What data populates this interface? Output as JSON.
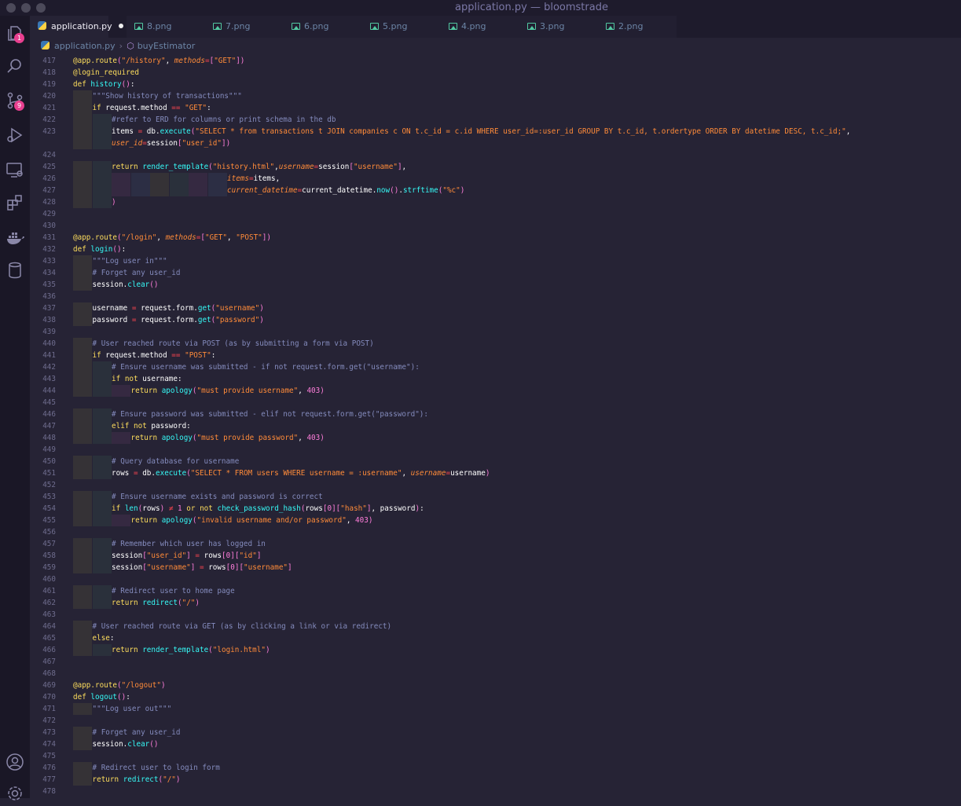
{
  "window": {
    "title": "application.py — bloomstrade"
  },
  "activity_bar": {
    "explorer_badge": "1",
    "source_control_badge": "9"
  },
  "tabs": [
    {
      "label": "application.py",
      "active": true,
      "modified": true,
      "icon": "python-icon"
    },
    {
      "label": "8.png",
      "icon": "image-icon"
    },
    {
      "label": "7.png",
      "icon": "image-icon"
    },
    {
      "label": "6.png",
      "icon": "image-icon"
    },
    {
      "label": "5.png",
      "icon": "image-icon"
    },
    {
      "label": "4.png",
      "icon": "image-icon"
    },
    {
      "label": "3.png",
      "icon": "image-icon"
    },
    {
      "label": "2.png",
      "icon": "image-icon"
    }
  ],
  "breadcrumb": {
    "file": "application.py",
    "symbol": "buyEstimator"
  },
  "lines": [
    {
      "n": "417",
      "indent": 0,
      "t": "@app.route(\"/history\", methods=[\"GET\"])"
    },
    {
      "n": "418",
      "indent": 0,
      "t": "@login_required"
    },
    {
      "n": "419",
      "indent": 0,
      "t": "def history():"
    },
    {
      "n": "420",
      "indent": 1,
      "t": "\"\"\"Show history of transactions\"\"\""
    },
    {
      "n": "421",
      "indent": 1,
      "t": "if request.method == \"GET\":"
    },
    {
      "n": "422",
      "indent": 2,
      "t": "#refer to ERD for columns or print schema in the db"
    },
    {
      "n": "423",
      "indent": 2,
      "t": "items = db.execute(\"SELECT * from transactions t JOIN companies c ON t.c_id = c.id WHERE user_id=:user_id GROUP BY t.c_id, t.ordertype ORDER BY datetime DESC, t.c_id;\","
    },
    {
      "n": "",
      "indent": 2,
      "t": "user_id=session[\"user_id\"])"
    },
    {
      "n": "424",
      "indent": 0,
      "t": ""
    },
    {
      "n": "425",
      "indent": 2,
      "t": "return render_template(\"history.html\",username=session[\"username\"],"
    },
    {
      "n": "426",
      "indent": 8,
      "t": "items=items,"
    },
    {
      "n": "427",
      "indent": 8,
      "t": "current_datetime=current_datetime.now().strftime(\"%c\")"
    },
    {
      "n": "428",
      "indent": 2,
      "t": ")"
    },
    {
      "n": "429",
      "indent": 0,
      "t": ""
    },
    {
      "n": "430",
      "indent": 0,
      "t": ""
    },
    {
      "n": "431",
      "indent": 0,
      "t": "@app.route(\"/login\", methods=[\"GET\", \"POST\"])"
    },
    {
      "n": "432",
      "indent": 0,
      "t": "def login():"
    },
    {
      "n": "433",
      "indent": 1,
      "t": "\"\"\"Log user in\"\"\""
    },
    {
      "n": "434",
      "indent": 1,
      "t": "# Forget any user_id"
    },
    {
      "n": "435",
      "indent": 1,
      "t": "session.clear()"
    },
    {
      "n": "436",
      "indent": 0,
      "t": ""
    },
    {
      "n": "437",
      "indent": 1,
      "t": "username = request.form.get(\"username\")"
    },
    {
      "n": "438",
      "indent": 1,
      "t": "password = request.form.get(\"password\")"
    },
    {
      "n": "439",
      "indent": 0,
      "t": ""
    },
    {
      "n": "440",
      "indent": 1,
      "t": "# User reached route via POST (as by submitting a form via POST)"
    },
    {
      "n": "441",
      "indent": 1,
      "t": "if request.method == \"POST\":"
    },
    {
      "n": "442",
      "indent": 2,
      "t": "# Ensure username was submitted - if not request.form.get(\"username\"):"
    },
    {
      "n": "443",
      "indent": 2,
      "t": "if not username:"
    },
    {
      "n": "444",
      "indent": 3,
      "t": "return apology(\"must provide username\", 403)"
    },
    {
      "n": "445",
      "indent": 0,
      "t": ""
    },
    {
      "n": "446",
      "indent": 2,
      "t": "# Ensure password was submitted - elif not request.form.get(\"password\"):"
    },
    {
      "n": "447",
      "indent": 2,
      "t": "elif not password:"
    },
    {
      "n": "448",
      "indent": 3,
      "t": "return apology(\"must provide password\", 403)"
    },
    {
      "n": "449",
      "indent": 0,
      "t": ""
    },
    {
      "n": "450",
      "indent": 2,
      "t": "# Query database for username"
    },
    {
      "n": "451",
      "indent": 2,
      "t": "rows = db.execute(\"SELECT * FROM users WHERE username = :username\", username=username)"
    },
    {
      "n": "452",
      "indent": 0,
      "t": ""
    },
    {
      "n": "453",
      "indent": 2,
      "t": "# Ensure username exists and password is correct"
    },
    {
      "n": "454",
      "indent": 2,
      "t": "if len(rows) ≠ 1 or not check_password_hash(rows[0][\"hash\"], password):"
    },
    {
      "n": "455",
      "indent": 3,
      "t": "return apology(\"invalid username and/or password\", 403)"
    },
    {
      "n": "456",
      "indent": 0,
      "t": ""
    },
    {
      "n": "457",
      "indent": 2,
      "t": "# Remember which user has logged in"
    },
    {
      "n": "458",
      "indent": 2,
      "t": "session[\"user_id\"] = rows[0][\"id\"]"
    },
    {
      "n": "459",
      "indent": 2,
      "t": "session[\"username\"] = rows[0][\"username\"]"
    },
    {
      "n": "460",
      "indent": 0,
      "t": ""
    },
    {
      "n": "461",
      "indent": 2,
      "t": "# Redirect user to home page"
    },
    {
      "n": "462",
      "indent": 2,
      "t": "return redirect(\"/\")"
    },
    {
      "n": "463",
      "indent": 0,
      "t": ""
    },
    {
      "n": "464",
      "indent": 1,
      "t": "# User reached route via GET (as by clicking a link or via redirect)"
    },
    {
      "n": "465",
      "indent": 1,
      "t": "else:"
    },
    {
      "n": "466",
      "indent": 2,
      "t": "return render_template(\"login.html\")"
    },
    {
      "n": "467",
      "indent": 0,
      "t": ""
    },
    {
      "n": "468",
      "indent": 0,
      "t": ""
    },
    {
      "n": "469",
      "indent": 0,
      "t": "@app.route(\"/logout\")"
    },
    {
      "n": "470",
      "indent": 0,
      "t": "def logout():"
    },
    {
      "n": "471",
      "indent": 1,
      "t": "\"\"\"Log user out\"\"\""
    },
    {
      "n": "472",
      "indent": 0,
      "t": ""
    },
    {
      "n": "473",
      "indent": 1,
      "t": "# Forget any user_id"
    },
    {
      "n": "474",
      "indent": 1,
      "t": "session.clear()"
    },
    {
      "n": "475",
      "indent": 0,
      "t": ""
    },
    {
      "n": "476",
      "indent": 1,
      "t": "# Redirect user to login form"
    },
    {
      "n": "477",
      "indent": 1,
      "t": "return redirect(\"/\")"
    },
    {
      "n": "478",
      "indent": 0,
      "t": ""
    }
  ]
}
